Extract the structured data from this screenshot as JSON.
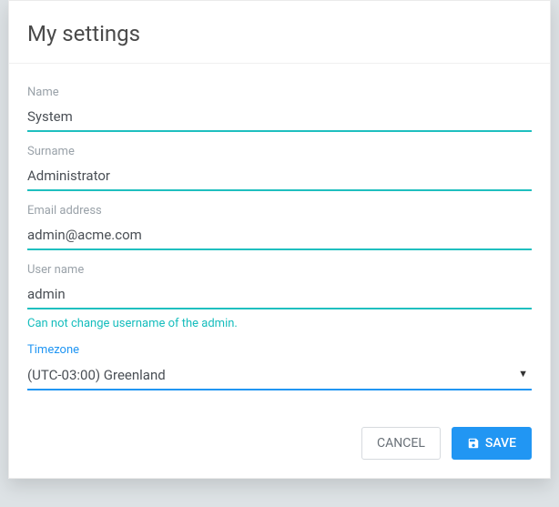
{
  "dialog": {
    "title": "My settings"
  },
  "fields": {
    "name": {
      "label": "Name",
      "value": "System"
    },
    "surname": {
      "label": "Surname",
      "value": "Administrator"
    },
    "email": {
      "label": "Email address",
      "value": "admin@acme.com"
    },
    "username": {
      "label": "User name",
      "value": "admin",
      "hint": "Can not change username of the admin."
    },
    "timezone": {
      "label": "Timezone",
      "value": "(UTC-03:00) Greenland"
    }
  },
  "buttons": {
    "cancel": "CANCEL",
    "save": "SAVE"
  },
  "colors": {
    "teal": "#1fbfbf",
    "blue": "#2196f3"
  }
}
